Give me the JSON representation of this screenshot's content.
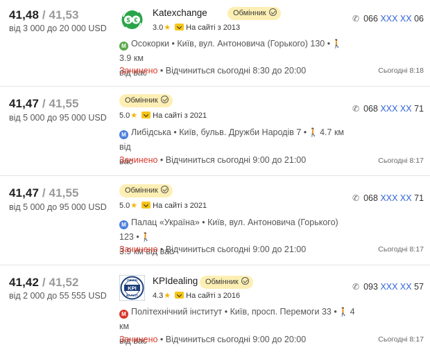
{
  "colors": {
    "metro_green": "#5aa84a",
    "metro_blue": "#4a7fdc",
    "metro_red": "#d8352a",
    "closed": "#d83a2a",
    "link": "#2f63d6",
    "badge_bg": "#fdefb4"
  },
  "offers": [
    {
      "buy": "41,48",
      "sell": "41,53",
      "range": "від 3 000 до 20 000 USD",
      "name": "Katexchange",
      "badge": "Обмінник",
      "rating": "3.0",
      "since": "На сайті з 2013",
      "metro_icon": "metro-green-icon",
      "metro": "Осокорки",
      "address_line1": "Осокорки • Київ, вул. Антоновича (Горького) 130 •",
      "address_line2": "3.9 км",
      "address_line3": "від вас",
      "status_closed": "Зачинено",
      "status_rest": " • Відчиниться сьогодні 8:30 до 20:00",
      "phone_prefix": "066",
      "phone_hidden": "XXX XX",
      "phone_suffix": "06",
      "updated": "Сьогодні 8:18"
    },
    {
      "buy": "41,47",
      "sell": "41,55",
      "range": "від 5 000 до 95 000 USD",
      "name": "",
      "badge": "Обмінник",
      "rating": "5.0",
      "since": "На сайті з 2021",
      "metro_icon": "metro-blue-icon",
      "address_line1": "Либідська • Київ, бульв. Дружби Народів 7 •",
      "address_line2": "4.7 км від",
      "address_line3": "вас",
      "status_closed": "Зачинено",
      "status_rest": " • Відчиниться сьогодні 9:00 до 21:00",
      "phone_prefix": "068",
      "phone_hidden": "XXX XX",
      "phone_suffix": "71",
      "updated": "Сьогодні 8:17"
    },
    {
      "buy": "41,47",
      "sell": "41,55",
      "range": "від 5 000 до 95 000 USD",
      "name": "",
      "badge": "Обмінник",
      "rating": "5.0",
      "since": "На сайті з 2021",
      "metro_icon": "metro-blue-icon",
      "address_line1": "Палац «Україна» • Київ, вул. Антоновича (Горького) 123 •",
      "address_line2": "",
      "address_line3": "3.9 км від вас",
      "status_closed": "Зачинено",
      "status_rest": " • Відчиниться сьогодні 9:00 до 21:00",
      "phone_prefix": "068",
      "phone_hidden": "XXX XX",
      "phone_suffix": "71",
      "updated": "Сьогодні 8:17"
    },
    {
      "buy": "41,42",
      "sell": "41,52",
      "range": "від 2 000 до 55 555 USD",
      "name": "KPIdealing",
      "badge": "Обмінник",
      "rating": "4.3",
      "since": "На сайті з 2016",
      "metro_icon": "metro-red-icon",
      "address_line1": "Політехнічний інститут • Київ, просп. Перемоги 33 •",
      "address_line2": "4 км",
      "address_line3": "від вас",
      "status_closed": "Зачинено",
      "status_rest": " • Відчиниться сьогодні 9:00 до 20:00",
      "phone_prefix": "093",
      "phone_hidden": "XXX XX",
      "phone_suffix": "57",
      "updated": "Сьогодні 8:17"
    }
  ],
  "logos": {
    "katexchange": {
      "icon": "currency-exchange-logo",
      "text": "$€"
    },
    "kpidealing": {
      "icon": "kpi-logo",
      "top": "ОБМІН",
      "mid": "KPI",
      "bottom": "ВАЛЮТ"
    }
  }
}
